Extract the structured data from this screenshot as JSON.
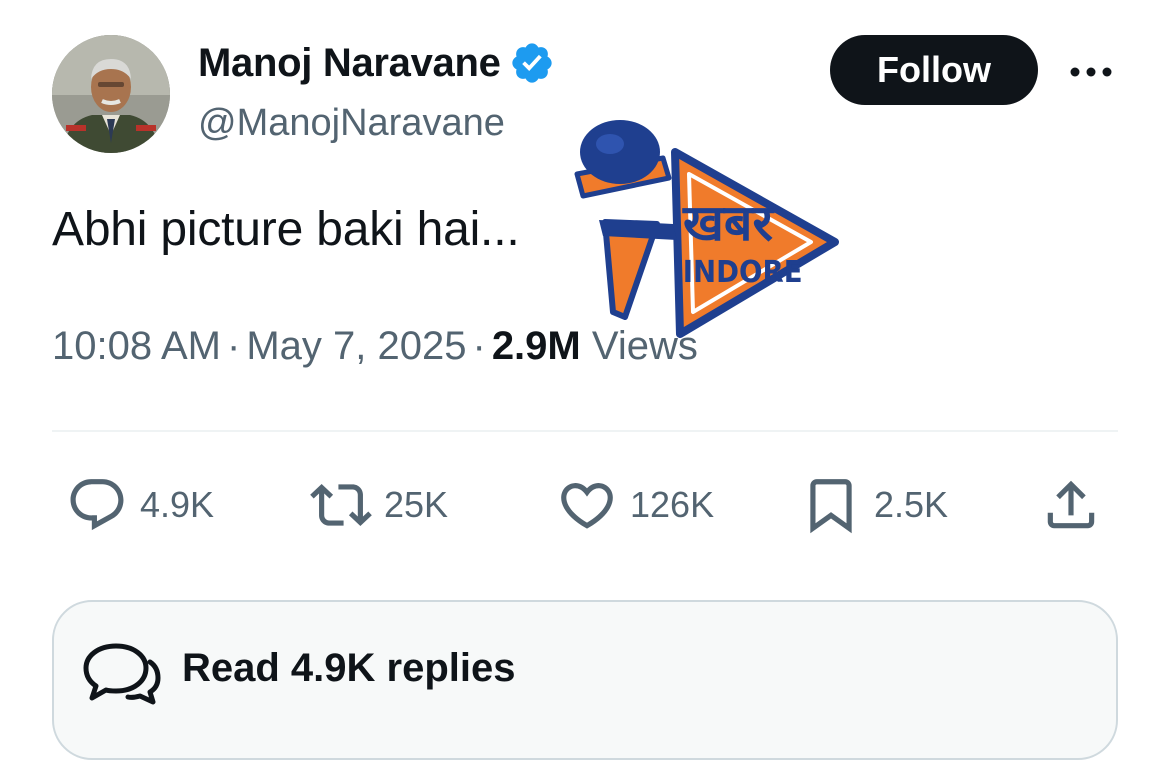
{
  "author": {
    "name": "Manoj Naravane",
    "handle": "@ManojNaravane",
    "verified": true
  },
  "follow_label": "Follow",
  "tweet": {
    "text": "Abhi picture baki hai...",
    "time": "10:08 AM",
    "date": "May 7, 2025",
    "separator": "·",
    "views_count": "2.9M",
    "views_label": "Views"
  },
  "actions": {
    "replies": "4.9K",
    "reposts": "25K",
    "likes": "126K",
    "bookmarks": "2.5K"
  },
  "read_replies_label": "Read 4.9K replies",
  "watermark": {
    "line1": "खबर",
    "line2": "INDORE"
  },
  "colors": {
    "verified": "#1d9bf0",
    "follow_bg": "#0f1419",
    "secondary_text": "#536471",
    "watermark_orange": "#f07b2b",
    "watermark_blue": "#1f3f8f"
  },
  "icons": [
    "verified-badge-icon",
    "more-icon",
    "reply-icon",
    "repost-icon",
    "like-icon",
    "bookmark-icon",
    "share-icon",
    "replies-bubble-icon"
  ]
}
